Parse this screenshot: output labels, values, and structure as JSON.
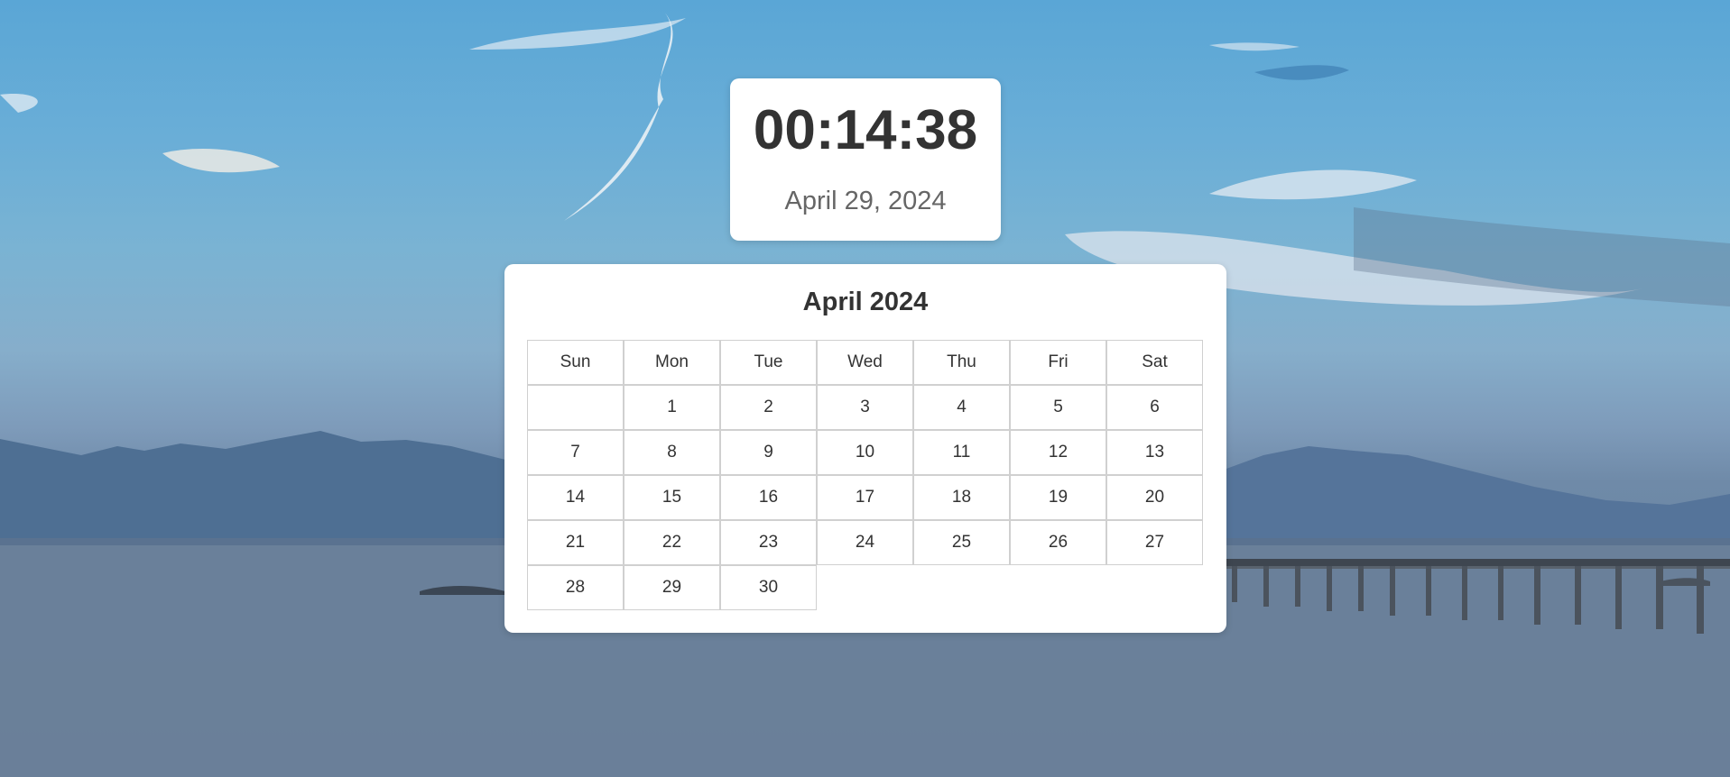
{
  "clock": {
    "time": "00:14:38",
    "date": "April 29, 2024"
  },
  "calendar": {
    "title": "April 2024",
    "weekdays": [
      "Sun",
      "Mon",
      "Tue",
      "Wed",
      "Thu",
      "Fri",
      "Sat"
    ],
    "weeks": [
      [
        "",
        "1",
        "2",
        "3",
        "4",
        "5",
        "6"
      ],
      [
        "7",
        "8",
        "9",
        "10",
        "11",
        "12",
        "13"
      ],
      [
        "14",
        "15",
        "16",
        "17",
        "18",
        "19",
        "20"
      ],
      [
        "21",
        "22",
        "23",
        "24",
        "25",
        "26",
        "27"
      ],
      [
        "28",
        "29",
        "30"
      ]
    ]
  },
  "colors": {
    "card_background": "#ffffff",
    "time_text": "#333333",
    "date_text": "#666666",
    "grid_border": "#d0d0d0"
  }
}
